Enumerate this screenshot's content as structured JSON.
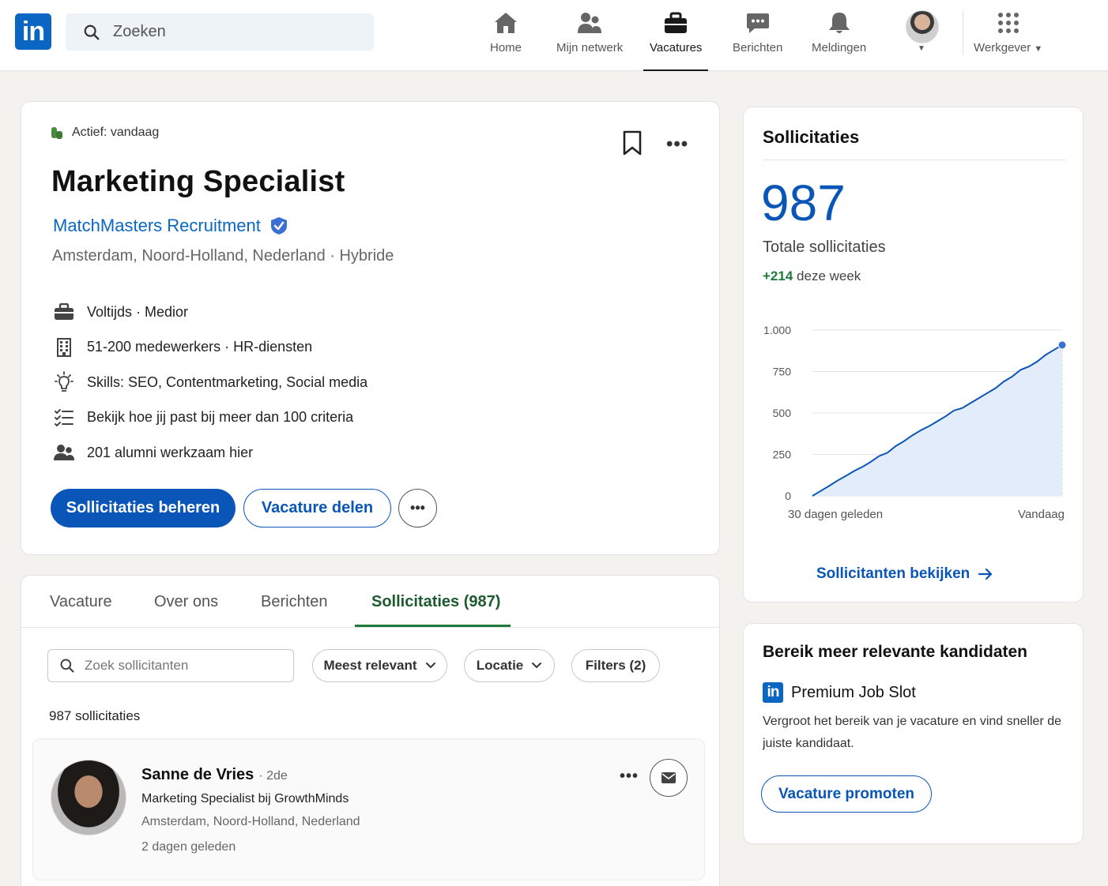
{
  "nav": {
    "logo_text": "in",
    "search_placeholder": "Zoeken",
    "items": [
      {
        "label": "Home",
        "icon": "home-icon"
      },
      {
        "label": "Mijn netwerk",
        "icon": "network-icon"
      },
      {
        "label": "Vacatures",
        "icon": "briefcase-icon",
        "active": true
      },
      {
        "label": "Berichten",
        "icon": "messages-icon"
      },
      {
        "label": "Meldingen",
        "icon": "bell-icon"
      }
    ],
    "employer_label": "Werkgever"
  },
  "job": {
    "status": "Actief: vandaag",
    "title": "Marketing Specialist",
    "company": "MatchMasters Recruitment",
    "location": "Amsterdam, Noord-Holland, Nederland · Hybride",
    "facts": [
      {
        "icon": "briefcase-icon",
        "text": "Voltijds · Medior"
      },
      {
        "icon": "building-icon",
        "text": "51-200 medewerkers · HR-diensten"
      },
      {
        "icon": "lightbulb-icon",
        "text": "Skills: SEO, Contentmarketing, Social media"
      },
      {
        "icon": "checklist-icon",
        "text": "Bekijk hoe jij past bij meer dan 100 criteria"
      },
      {
        "icon": "people-icon",
        "text": "201 alumni werkzaam hier"
      }
    ],
    "primary_button": "Sollicitaties beheren",
    "share_button": "Vacature delen"
  },
  "applications": {
    "tabs": [
      "Vacature",
      "Over ons",
      "Berichten",
      "Sollicitaties (987)"
    ],
    "active_tab": 3,
    "search_placeholder": "Zoek sollicitanten",
    "sort_label": "Meest relevant",
    "location_filter": "Locatie",
    "filters_label": "Filters (2)",
    "count_text": "987 sollicitaties",
    "applicant": {
      "name": "Sanne de Vries",
      "degree": "· 2de",
      "headline": "Marketing Specialist bij GrowthMinds",
      "location": "Amsterdam, Noord-Holland, Nederland",
      "time": "2 dagen geleden"
    }
  },
  "stats": {
    "title": "Sollicitaties",
    "total": "987",
    "total_label": "Totale sollicitaties",
    "week_delta": "+214",
    "week_label": "deze week",
    "link": "Sollicitanten bekijken"
  },
  "chart_data": {
    "type": "area",
    "x_start_label": "30 dagen geleden",
    "x_end_label": "Vandaag",
    "yticks": [
      "0",
      "250",
      "500",
      "750",
      "1.000"
    ],
    "ylim": [
      0,
      1000
    ],
    "grid": true,
    "days": [
      0,
      1,
      2,
      3,
      4,
      5,
      6,
      7,
      8,
      9,
      10,
      11,
      12,
      13,
      14,
      15,
      16,
      17,
      18,
      19,
      20,
      21,
      22,
      23,
      24,
      25,
      26,
      27,
      28,
      29,
      30
    ],
    "values": [
      0,
      30,
      60,
      92,
      120,
      150,
      175,
      205,
      240,
      260,
      300,
      330,
      365,
      395,
      420,
      450,
      480,
      515,
      530,
      560,
      590,
      620,
      650,
      690,
      720,
      760,
      780,
      810,
      850,
      880,
      910
    ],
    "color": "#0a56b8"
  },
  "promo": {
    "title": "Bereik meer relevante kandidaten",
    "logo_text": "in",
    "product": "Premium Job Slot",
    "description": "Vergroot het bereik van je vacature en vind sneller de juiste kandidaat.",
    "button": "Vacature promoten"
  }
}
